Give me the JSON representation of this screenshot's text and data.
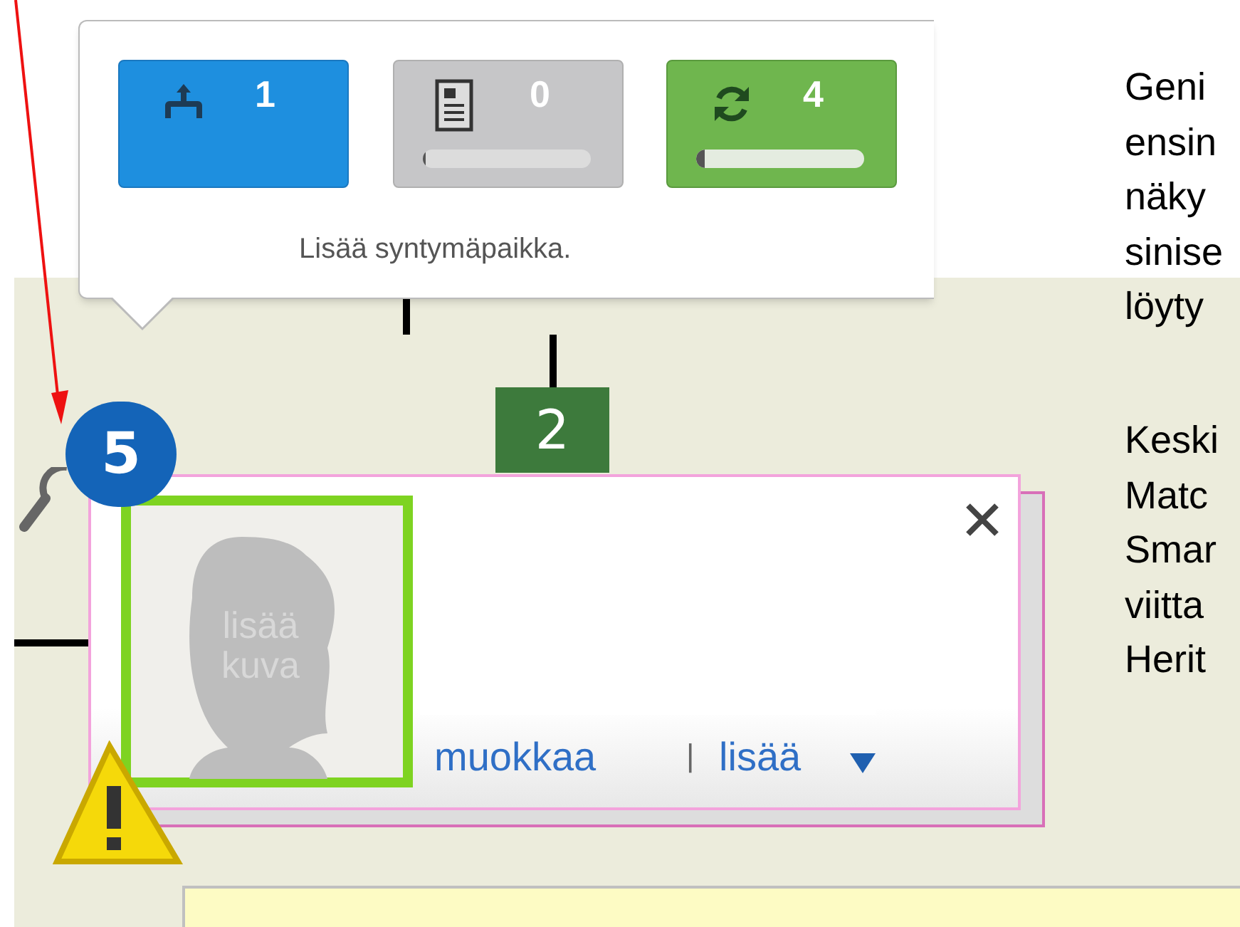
{
  "tooltip": {
    "buttons": [
      {
        "kind": "relatives",
        "count": "1"
      },
      {
        "kind": "records",
        "count": "0",
        "level": 0
      },
      {
        "kind": "sync",
        "count": "4",
        "level": 0.05
      }
    ],
    "message": "Lisää syntymäpaikka."
  },
  "tree_node": {
    "number": "2"
  },
  "match_badge": {
    "count": "5"
  },
  "profile_card": {
    "photo_label": [
      "lisää",
      "kuva"
    ],
    "links": [
      "muokkaa",
      "lisää"
    ],
    "separator": "|"
  },
  "side_text": {
    "paragraphs": [
      [
        "Geni",
        "ensin",
        "näky",
        "sinise",
        "löyty"
      ],
      [
        "Keski",
        "Matc",
        "Smar",
        "viitta",
        "Herit"
      ]
    ]
  }
}
